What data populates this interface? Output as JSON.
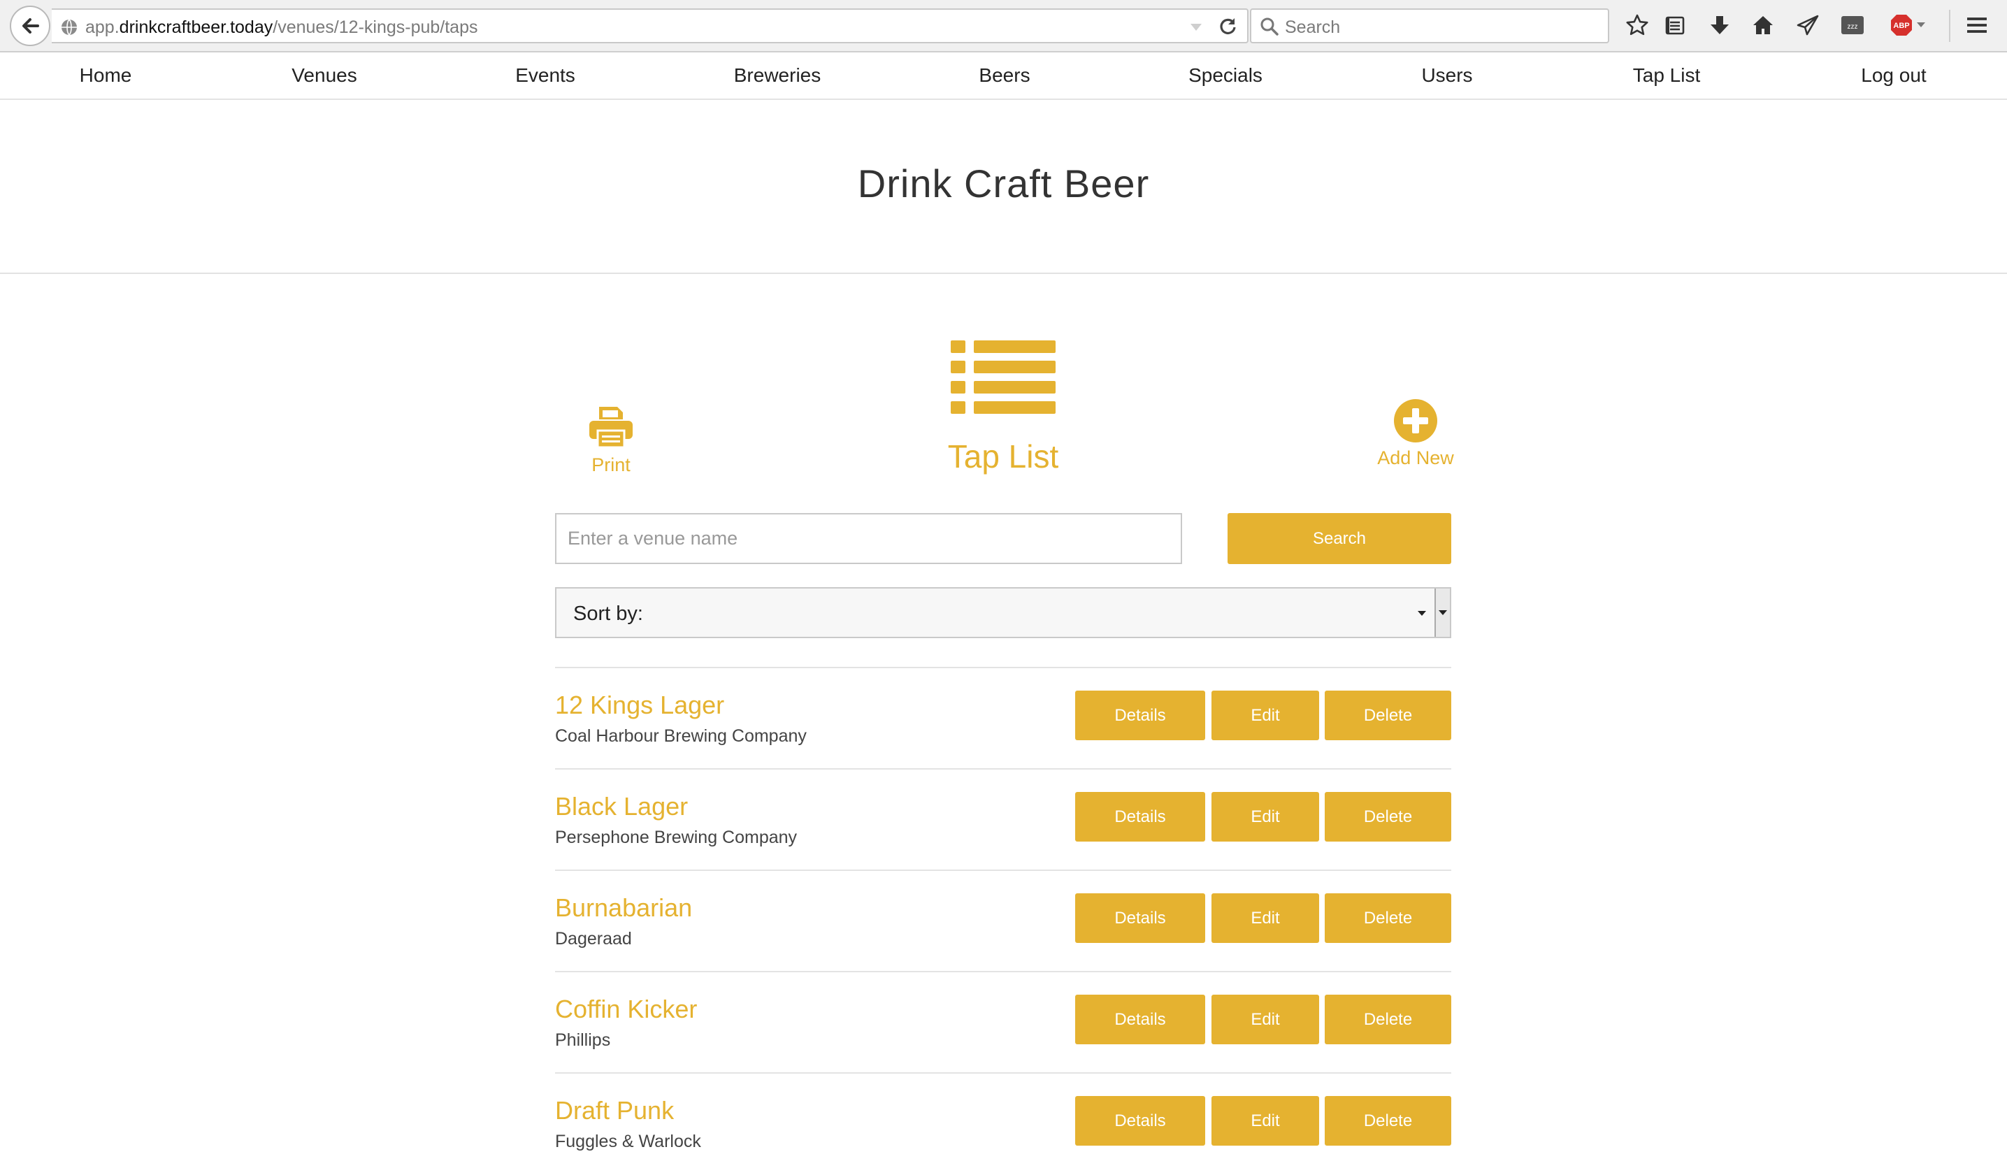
{
  "browser": {
    "url_prefix": "app.",
    "url_host": "drinkcraftbeer.today",
    "url_path": "/venues/12-kings-pub/taps",
    "search_placeholder": "Search",
    "toolbar_icons": [
      "star-icon",
      "reading-list-icon",
      "download-icon",
      "home-icon",
      "send-icon",
      "pocket-icon",
      "adblock-icon",
      "menu-icon"
    ],
    "adblock_label": "ABP"
  },
  "nav": {
    "items": [
      {
        "label": "Home"
      },
      {
        "label": "Venues"
      },
      {
        "label": "Events"
      },
      {
        "label": "Breweries"
      },
      {
        "label": "Beers"
      },
      {
        "label": "Specials"
      },
      {
        "label": "Users"
      },
      {
        "label": "Tap List"
      },
      {
        "label": "Log out"
      }
    ]
  },
  "site": {
    "title": "Drink Craft Beer"
  },
  "actions": {
    "print_label": "Print",
    "page_label": "Tap List",
    "add_label": "Add New"
  },
  "search": {
    "placeholder": "Enter a venue name",
    "value": "",
    "button_label": "Search"
  },
  "sort": {
    "label": "Sort by:"
  },
  "beers": [
    {
      "name": "12 Kings Lager",
      "brewery": "Coal Harbour Brewing Company"
    },
    {
      "name": "Black Lager",
      "brewery": "Persephone Brewing Company"
    },
    {
      "name": "Burnabarian",
      "brewery": "Dageraad"
    },
    {
      "name": "Coffin Kicker",
      "brewery": "Phillips"
    },
    {
      "name": "Draft Punk",
      "brewery": "Fuggles & Warlock"
    }
  ],
  "row_buttons": {
    "details": "Details",
    "edit": "Edit",
    "delete": "Delete"
  },
  "colors": {
    "accent": "#e5b230",
    "text": "#333333",
    "rule": "#e3e3e3"
  }
}
